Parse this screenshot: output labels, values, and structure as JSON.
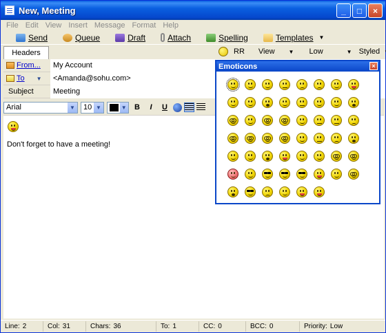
{
  "window": {
    "title": "New, Meeting",
    "buttons": {
      "minimize": "_",
      "maximize": "□",
      "close": "×"
    }
  },
  "menu": [
    "File",
    "Edit",
    "View",
    "Insert",
    "Message",
    "Format",
    "Help"
  ],
  "toolbar": {
    "send": "Send",
    "queue": "Queue",
    "draft": "Draft",
    "attach": "Attach",
    "spelling": "Spelling",
    "templates": "Templates"
  },
  "header_tab": "Headers",
  "right_tools": {
    "rr": "RR",
    "view": "View",
    "priority": "Low",
    "style": "Styled"
  },
  "fields": {
    "from_label": "From...",
    "from_value": "My Account",
    "to_label": "To",
    "to_value": "<Amanda@sohu.com>",
    "subject_label": "Subject",
    "subject_value": "Meeting"
  },
  "format": {
    "font": "Arial",
    "size": "10",
    "bold": "B",
    "italic": "I",
    "underline": "U"
  },
  "editor": {
    "body_text": "Don't forget to have a meeting!"
  },
  "emoticons": {
    "title": "Emoticons",
    "close": "×",
    "rows": [
      [
        "smile-sel",
        "grin",
        "smile",
        "flat",
        "sad",
        "sad",
        "smile",
        "tongue"
      ],
      [
        "smile",
        "smile",
        "open",
        "smile",
        "flat",
        "smile",
        "smile",
        "open"
      ],
      [
        "glasses",
        "smile",
        "glasses",
        "glasses",
        "smile",
        "flat",
        "flat",
        "sad"
      ],
      [
        "glasses",
        "glasses",
        "glasses",
        "glasses",
        "smile",
        "flat",
        "sad",
        "open"
      ],
      [
        "smile",
        "grin",
        "open",
        "tongue",
        "smile",
        "smile",
        "glasses",
        "glasses"
      ],
      [
        "red",
        "grin",
        "shades",
        "shades",
        "shades",
        "tongue",
        "smile",
        "glasses"
      ],
      [
        "open",
        "shades",
        "sad",
        "smile",
        "tongue",
        "tongue"
      ]
    ]
  },
  "status": {
    "line_label": "Line:",
    "line": "2",
    "col_label": "Col:",
    "col": "31",
    "chars_label": "Chars:",
    "chars": "36",
    "to_label": "To:",
    "to": "1",
    "cc_label": "CC:",
    "cc": "0",
    "bcc_label": "BCC:",
    "bcc": "0",
    "priority_label": "Priority:",
    "priority": "Low"
  }
}
